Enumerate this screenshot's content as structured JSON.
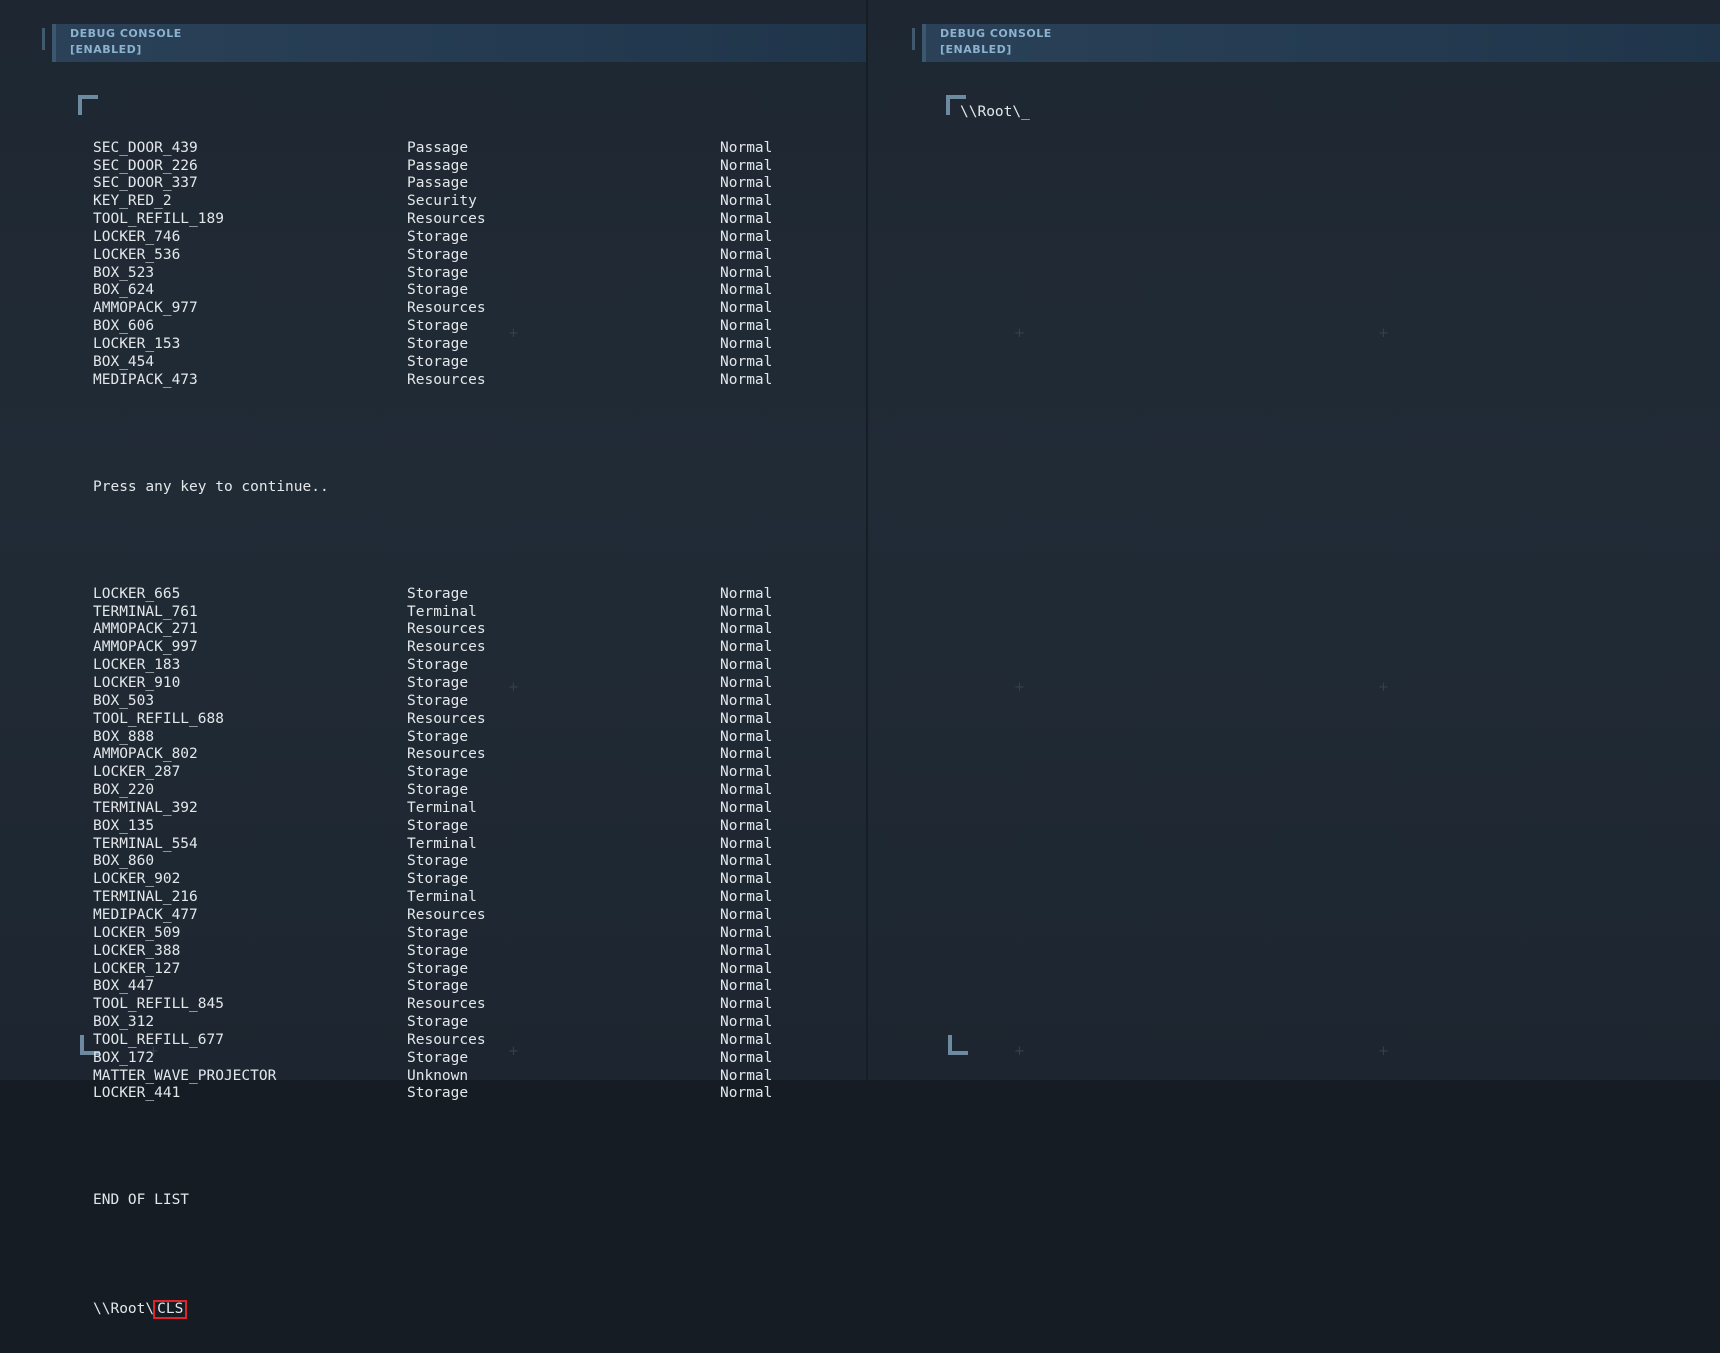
{
  "left_console": {
    "header_line1": "DEBUG CONSOLE",
    "header_line2": "[ENABLED]",
    "list_part1": [
      [
        "SEC_DOOR_439",
        "Passage",
        "Normal"
      ],
      [
        "SEC_DOOR_226",
        "Passage",
        "Normal"
      ],
      [
        "SEC_DOOR_337",
        "Passage",
        "Normal"
      ],
      [
        "KEY_RED_2",
        "Security",
        "Normal"
      ],
      [
        "TOOL_REFILL_189",
        "Resources",
        "Normal"
      ],
      [
        "LOCKER_746",
        "Storage",
        "Normal"
      ],
      [
        "LOCKER_536",
        "Storage",
        "Normal"
      ],
      [
        "BOX_523",
        "Storage",
        "Normal"
      ],
      [
        "BOX_624",
        "Storage",
        "Normal"
      ],
      [
        "AMMOPACK_977",
        "Resources",
        "Normal"
      ],
      [
        "BOX_606",
        "Storage",
        "Normal"
      ],
      [
        "LOCKER_153",
        "Storage",
        "Normal"
      ],
      [
        "BOX_454",
        "Storage",
        "Normal"
      ],
      [
        "MEDIPACK_473",
        "Resources",
        "Normal"
      ]
    ],
    "continue_text": "Press any key to continue..",
    "list_part2": [
      [
        "LOCKER_665",
        "Storage",
        "Normal"
      ],
      [
        "TERMINAL_761",
        "Terminal",
        "Normal"
      ],
      [
        "AMMOPACK_271",
        "Resources",
        "Normal"
      ],
      [
        "AMMOPACK_997",
        "Resources",
        "Normal"
      ],
      [
        "LOCKER_183",
        "Storage",
        "Normal"
      ],
      [
        "LOCKER_910",
        "Storage",
        "Normal"
      ],
      [
        "BOX_503",
        "Storage",
        "Normal"
      ],
      [
        "TOOL_REFILL_688",
        "Resources",
        "Normal"
      ],
      [
        "BOX_888",
        "Storage",
        "Normal"
      ],
      [
        "AMMOPACK_802",
        "Resources",
        "Normal"
      ],
      [
        "LOCKER_287",
        "Storage",
        "Normal"
      ],
      [
        "BOX_220",
        "Storage",
        "Normal"
      ],
      [
        "TERMINAL_392",
        "Terminal",
        "Normal"
      ],
      [
        "BOX_135",
        "Storage",
        "Normal"
      ],
      [
        "TERMINAL_554",
        "Terminal",
        "Normal"
      ],
      [
        "BOX_860",
        "Storage",
        "Normal"
      ],
      [
        "LOCKER_902",
        "Storage",
        "Normal"
      ],
      [
        "TERMINAL_216",
        "Terminal",
        "Normal"
      ],
      [
        "MEDIPACK_477",
        "Resources",
        "Normal"
      ],
      [
        "LOCKER_509",
        "Storage",
        "Normal"
      ],
      [
        "LOCKER_388",
        "Storage",
        "Normal"
      ],
      [
        "LOCKER_127",
        "Storage",
        "Normal"
      ],
      [
        "BOX_447",
        "Storage",
        "Normal"
      ],
      [
        "TOOL_REFILL_845",
        "Resources",
        "Normal"
      ],
      [
        "BOX_312",
        "Storage",
        "Normal"
      ],
      [
        "TOOL_REFILL_677",
        "Resources",
        "Normal"
      ],
      [
        "BOX_172",
        "Storage",
        "Normal"
      ],
      [
        "MATTER_WAVE_PROJECTOR",
        "Unknown",
        "Normal"
      ],
      [
        "LOCKER_441",
        "Storage",
        "Normal"
      ]
    ],
    "end_text": "END OF LIST",
    "prompt_path": "\\\\Root\\",
    "prompt_command": "CLS"
  },
  "right_console": {
    "header_line1": "DEBUG CONSOLE",
    "header_line2": "[ENABLED]",
    "prompt": "\\\\Root\\_"
  },
  "colors": {
    "text": "#e3e7ea",
    "header_bg": "#233a50",
    "header_text": "#8bb2cf",
    "highlight_box": "#e0242a",
    "bracket": "#6d8aa1"
  }
}
